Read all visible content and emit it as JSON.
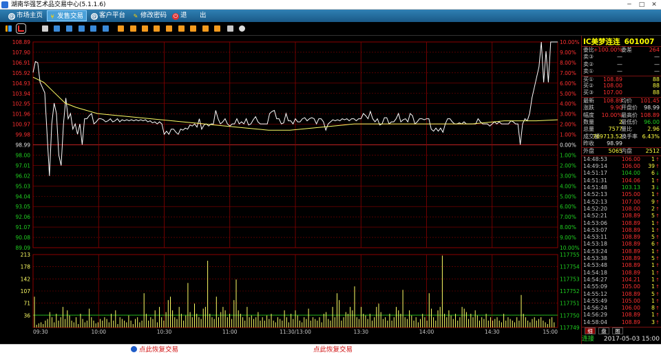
{
  "window": {
    "title": "湖南华强艺术品交易中心(5.1.1.6)",
    "minimize": "─",
    "maximize": "□",
    "close": "✕"
  },
  "menu": [
    {
      "label": "市场主页",
      "icon": "globe-icon",
      "active": false
    },
    {
      "label": "发售交易",
      "icon": "yen-icon",
      "active": true
    },
    {
      "label": "客户平台",
      "icon": "globe-icon",
      "active": false
    },
    {
      "label": "修改密码",
      "icon": "pen-icon",
      "active": false
    },
    {
      "label": "退",
      "icon": "power-icon",
      "active": false
    },
    {
      "label": "出",
      "icon": "",
      "active": false
    }
  ],
  "toolbar_icons": [
    "bar-chart-icon",
    "line-chart-icon",
    "table-icon",
    "grid-icon",
    "list-icon",
    "list-alt-icon",
    "window-icon",
    "x-icon",
    "orange-1-icon",
    "orange-2-icon",
    "orange-3-icon",
    "orange-4-icon",
    "orange-5-icon",
    "orange-6-icon",
    "orange-7-icon",
    "orange-8-icon",
    "orange-9-icon",
    "pencil-icon",
    "gear-icon"
  ],
  "colors": {
    "up": "#ff3030",
    "down": "#20d020",
    "price_line": "#ffffff",
    "avg_line": "#ffff66",
    "grid": "#8b0000",
    "volume": "#ffff66",
    "accent": "#2f7fb3"
  },
  "chart_data": [
    {
      "type": "line",
      "name": "intraday-price",
      "series": [
        {
          "name": "",
          "values": [
            105.95,
            107.0,
            106.9,
            105.0,
            104.5,
            104.0,
            100.0,
            96.0,
            101.0,
            103.0,
            102.0,
            98.0,
            97.0,
            101.0,
            103.5,
            101.5,
            102.0,
            100.5,
            101.0,
            100.0,
            101.0,
            99.0,
            101.5,
            101.5,
            101.8,
            102.0,
            101.0,
            101.2,
            101.5,
            101.5,
            101.4,
            101.2,
            101.3,
            101.5,
            101.2,
            101.3,
            101.5,
            101.2,
            101.4,
            101.3,
            101.4,
            101.3,
            101.4,
            101.3,
            101.4,
            101.3,
            101.4,
            101.3,
            101.4,
            101.2,
            101.3,
            101.1,
            101.2,
            101.0,
            101.2,
            101.0,
            100.0,
            100.3,
            100.0,
            100.5,
            100.5,
            100.2,
            100.0,
            100.5,
            100.4,
            100.6,
            100.5,
            100.9,
            100.8,
            101.0,
            100.7,
            101.5,
            100.5,
            100.9,
            101.0,
            100.8,
            101.0,
            101.0,
            102.3,
            101.5,
            101.0,
            101.2,
            101.5,
            101.0,
            100.8,
            101.0,
            101.0,
            101.5,
            101.0,
            101.2,
            101.0,
            101.5,
            100.9,
            101.0,
            101.4,
            101.7,
            101.2,
            101.0,
            101.0,
            101.0,
            101.0,
            102.0,
            102.2,
            102.3,
            101.5,
            101.5,
            101.0,
            101.1,
            102.0,
            101.3,
            101.3,
            101.0,
            101.5,
            101.2,
            101.2,
            101.5,
            101.6,
            101.3,
            101.5,
            101.6,
            101.5,
            101.0,
            101.5,
            101.5,
            101.2,
            100.4,
            101.0,
            101.2,
            101.4,
            101.3,
            101.4,
            101.3,
            101.5,
            101.4,
            101.5,
            101.3,
            101.5,
            101.5,
            101.3,
            101.5,
            101.5,
            102.0,
            101.8,
            101.5,
            102.2,
            101.5,
            101.2,
            101.5,
            100.9,
            101.0,
            101.6,
            101.6,
            101.0,
            101.2,
            101.2,
            101.5,
            102.0,
            101.2,
            101.4,
            101.5,
            101.2,
            102.0,
            101.8,
            101.0,
            101.2,
            101.5,
            101.5,
            101.4,
            101.5,
            101.5,
            100.5,
            100.3,
            100.6,
            100.3,
            100.6,
            100.2,
            101.0,
            101.5,
            101.5,
            101.2,
            101.0,
            101.0,
            101.1,
            101.0,
            101.2,
            101.0,
            101.0,
            101.0,
            101.0,
            101.0,
            101.5,
            101.2,
            101.0,
            101.0,
            101.0,
            100.8,
            101.0,
            101.2,
            101.0,
            101.2,
            101.0,
            101.0,
            101.0,
            101.0,
            101.3,
            101.2,
            101.0,
            101.0,
            99.0,
            101.0,
            101.5,
            101.3,
            102.0,
            103.5,
            104.5,
            105.5,
            106.5,
            108.89,
            105.0,
            108.0,
            105.0,
            108.89,
            108.89,
            108.89,
            108.89
          ]
        },
        {
          "name": "",
          "values": [
            105.5,
            105.0,
            104.0,
            103.0,
            102.6,
            102.3,
            102.0,
            101.9,
            101.8,
            101.7,
            101.6,
            101.5,
            101.4,
            101.3,
            101.2,
            101.1,
            101.0,
            100.9,
            100.8,
            100.7,
            100.6,
            100.5,
            100.4,
            100.4,
            100.4,
            100.5,
            100.6,
            100.7,
            100.8,
            100.9,
            101.0,
            101.0,
            101.0,
            101.0,
            101.0,
            101.0,
            101.0,
            101.0,
            101.0,
            101.0,
            101.0,
            101.0,
            101.1,
            101.2,
            101.3,
            101.3,
            101.3,
            101.3,
            101.35,
            101.4
          ]
        }
      ],
      "y_price_ticks": [
        108.89,
        107.9,
        106.91,
        105.92,
        104.93,
        103.94,
        102.95,
        101.96,
        100.97,
        99.98,
        98.99,
        98.0,
        97.01,
        96.02,
        95.03,
        94.04,
        93.05,
        92.06,
        91.07,
        90.08,
        89.09
      ],
      "y_pct_ticks": [
        "10.00%",
        "9.00%",
        "8.00%",
        "7.00%",
        "6.00%",
        "5.00%",
        "4.00%",
        "3.00%",
        "2.00%",
        "1.00%",
        "0.00%",
        "1.00%",
        "2.00%",
        "3.00%",
        "4.00%",
        "5.00%",
        "6.00%",
        "7.00%",
        "8.00%",
        "9.00%",
        "10.00%"
      ],
      "ylim": [
        89.09,
        108.89
      ],
      "prev_close": 98.99
    },
    {
      "type": "bar",
      "name": "intraday-volume",
      "y_ticks": [
        213,
        178,
        142,
        107,
        71,
        36
      ],
      "y_right_ticks": [
        117755,
        117754,
        117753,
        117752,
        117751,
        117750,
        117749
      ],
      "ylim": [
        0,
        213
      ],
      "reference_level": 36,
      "values": [
        90,
        8,
        12,
        15,
        10,
        20,
        25,
        45,
        30,
        15,
        40,
        20,
        30,
        60,
        25,
        50,
        35,
        20,
        15,
        30,
        10,
        40,
        25,
        15,
        20,
        55,
        30,
        20,
        12,
        15,
        25,
        20,
        30,
        25,
        15,
        40,
        20,
        50,
        10,
        30,
        25,
        20,
        15,
        35,
        20,
        10,
        25,
        30,
        15,
        20,
        100,
        40,
        20,
        30,
        25,
        50,
        15,
        60,
        30,
        20,
        45,
        80,
        90,
        50,
        30,
        25,
        60,
        40,
        20,
        35,
        130,
        45,
        30,
        70,
        40,
        30,
        25,
        55,
        60,
        195,
        40,
        30,
        25,
        90,
        30,
        45,
        60,
        50,
        30,
        40,
        25,
        80,
        140,
        50,
        40,
        30,
        20,
        60,
        30,
        35,
        25,
        30,
        45,
        20,
        30,
        20,
        35,
        25,
        40,
        20,
        15,
        30,
        25,
        20,
        50,
        30,
        15,
        40,
        25,
        50,
        35,
        20,
        15,
        30,
        25,
        55,
        20,
        30,
        25,
        20,
        30,
        15,
        40,
        45,
        25,
        20,
        60,
        30,
        100,
        80,
        20,
        30,
        45,
        40,
        60,
        50,
        120,
        30,
        25,
        60,
        40,
        35,
        25,
        40,
        20,
        30,
        60,
        70,
        45,
        25,
        30,
        20,
        40,
        20,
        30,
        60,
        50,
        40,
        110,
        30,
        25,
        50,
        35,
        20,
        30,
        15,
        25,
        40,
        30,
        20,
        100,
        55,
        30,
        20,
        50,
        60,
        210,
        40,
        30,
        50,
        35,
        25,
        40,
        20,
        30,
        60,
        55,
        45,
        25,
        40,
        30,
        50,
        35,
        20,
        30,
        25,
        40,
        20,
        30,
        20,
        25,
        30,
        20,
        15,
        40,
        20,
        30,
        25,
        20,
        15,
        30,
        20,
        95,
        40,
        30,
        20,
        15,
        25,
        30,
        20,
        25,
        30,
        20,
        15,
        10,
        25,
        30,
        15
      ]
    }
  ],
  "time_labels": [
    "09:30",
    "10:00",
    "10:30",
    "11:00",
    "11:30/13:00",
    "13:30",
    "14:00",
    "14:30",
    "15:00"
  ],
  "quote": {
    "name": "IC美梦连连",
    "code": "601007",
    "book": [
      {
        "l": "委比",
        "v1": "+100.00%",
        "l2": "委差",
        "v2": "264",
        "c1": "red",
        "c2": "red"
      },
      {
        "l": "卖③",
        "v1": "—",
        "l2": "",
        "v2": "—",
        "c1": "white",
        "c2": "white"
      },
      {
        "l": "卖②",
        "v1": "—",
        "l2": "",
        "v2": "—",
        "c1": "white",
        "c2": "white"
      },
      {
        "l": "卖①",
        "v1": "—",
        "l2": "",
        "v2": "—",
        "c1": "white",
        "c2": "white"
      },
      {
        "l": "买①",
        "v1": "108.89",
        "l2": "",
        "v2": "88",
        "c1": "red",
        "c2": "yellow"
      },
      {
        "l": "买②",
        "v1": "108.00",
        "l2": "",
        "v2": "88",
        "c1": "red",
        "c2": "yellow"
      },
      {
        "l": "买③",
        "v1": "107.00",
        "l2": "",
        "v2": "88",
        "c1": "red",
        "c2": "yellow"
      }
    ],
    "stats": [
      {
        "l": "最新",
        "v1": "108.89",
        "l2": "均价",
        "v2": "101.45",
        "c1": "red",
        "c2": "red"
      },
      {
        "l": "涨跌",
        "v1": "9.90",
        "l2": "开盘价",
        "v2": "98.99",
        "c1": "red",
        "c2": "white"
      },
      {
        "l": "幅度",
        "v1": "10.00%",
        "l2": "最高价",
        "v2": "108.89",
        "c1": "red",
        "c2": "red"
      },
      {
        "l": "数量",
        "v1": "2",
        "l2": "最低价",
        "v2": "96.00",
        "c1": "yellow",
        "c2": "green"
      },
      {
        "l": "总量",
        "v1": "7577",
        "l2": "量比",
        "v2": "2.96",
        "c1": "yellow",
        "c2": "yellow"
      },
      {
        "l": "成交额",
        "v1": "769713.52",
        "l2": "换手率",
        "v2": "6.43%",
        "c1": "yellow",
        "c2": "yellow"
      },
      {
        "l": "昨收",
        "v1": "98.99",
        "l2": "",
        "v2": "",
        "c1": "white",
        "c2": "white"
      }
    ],
    "outer_inner": {
      "l": "外盘",
      "v1": "5065",
      "l2": "内盘",
      "v2": "2512"
    },
    "trades": [
      {
        "t": "14:48:53",
        "p": "106.00",
        "q": "1",
        "d": "up"
      },
      {
        "t": "14:49:14",
        "p": "106.00",
        "q": "39",
        "d": "up"
      },
      {
        "t": "14:51:17",
        "p": "104.00",
        "q": "6",
        "d": "down"
      },
      {
        "t": "14:51:31",
        "p": "104.06",
        "q": "1",
        "d": "up"
      },
      {
        "t": "14:51:48",
        "p": "103.13",
        "q": "3",
        "d": "down"
      },
      {
        "t": "14:52:13",
        "p": "105.00",
        "q": "1",
        "d": "up"
      },
      {
        "t": "14:52:13",
        "p": "107.00",
        "q": "9",
        "d": "up"
      },
      {
        "t": "14:52:20",
        "p": "108.00",
        "q": "2",
        "d": "up"
      },
      {
        "t": "14:52:21",
        "p": "108.89",
        "q": "5",
        "d": "up"
      },
      {
        "t": "14:53:06",
        "p": "108.89",
        "q": "1",
        "d": "up"
      },
      {
        "t": "14:53:07",
        "p": "108.89",
        "q": "1",
        "d": "up"
      },
      {
        "t": "14:53:11",
        "p": "108.89",
        "q": "5",
        "d": "up"
      },
      {
        "t": "14:53:18",
        "p": "108.89",
        "q": "6",
        "d": "up"
      },
      {
        "t": "14:53:24",
        "p": "108.89",
        "q": "1",
        "d": "up"
      },
      {
        "t": "14:53:38",
        "p": "108.89",
        "q": "5",
        "d": "up"
      },
      {
        "t": "14:53:48",
        "p": "108.89",
        "q": "1",
        "d": "up"
      },
      {
        "t": "14:54:18",
        "p": "108.89",
        "q": "1",
        "d": "up"
      },
      {
        "t": "14:54:27",
        "p": "104.21",
        "q": "1",
        "d": "up"
      },
      {
        "t": "14:55:09",
        "p": "105.00",
        "q": "1",
        "d": "up"
      },
      {
        "t": "14:55:12",
        "p": "108.89",
        "q": "5",
        "d": "up"
      },
      {
        "t": "14:55:49",
        "p": "105.00",
        "q": "1",
        "d": "up"
      },
      {
        "t": "14:56:24",
        "p": "106.00",
        "q": "8",
        "d": "up"
      },
      {
        "t": "14:56:29",
        "p": "108.89",
        "q": "1",
        "d": "up"
      },
      {
        "t": "14:58:04",
        "p": "108.89",
        "q": "3",
        "d": "up"
      }
    ],
    "tabs": [
      "细",
      "盘",
      "图"
    ],
    "status": "连接",
    "datetime": "2017-05-03 15:00"
  },
  "statusbar": {
    "restore_left": "点此恢复交易",
    "restore_right": "点此恢复交易"
  }
}
